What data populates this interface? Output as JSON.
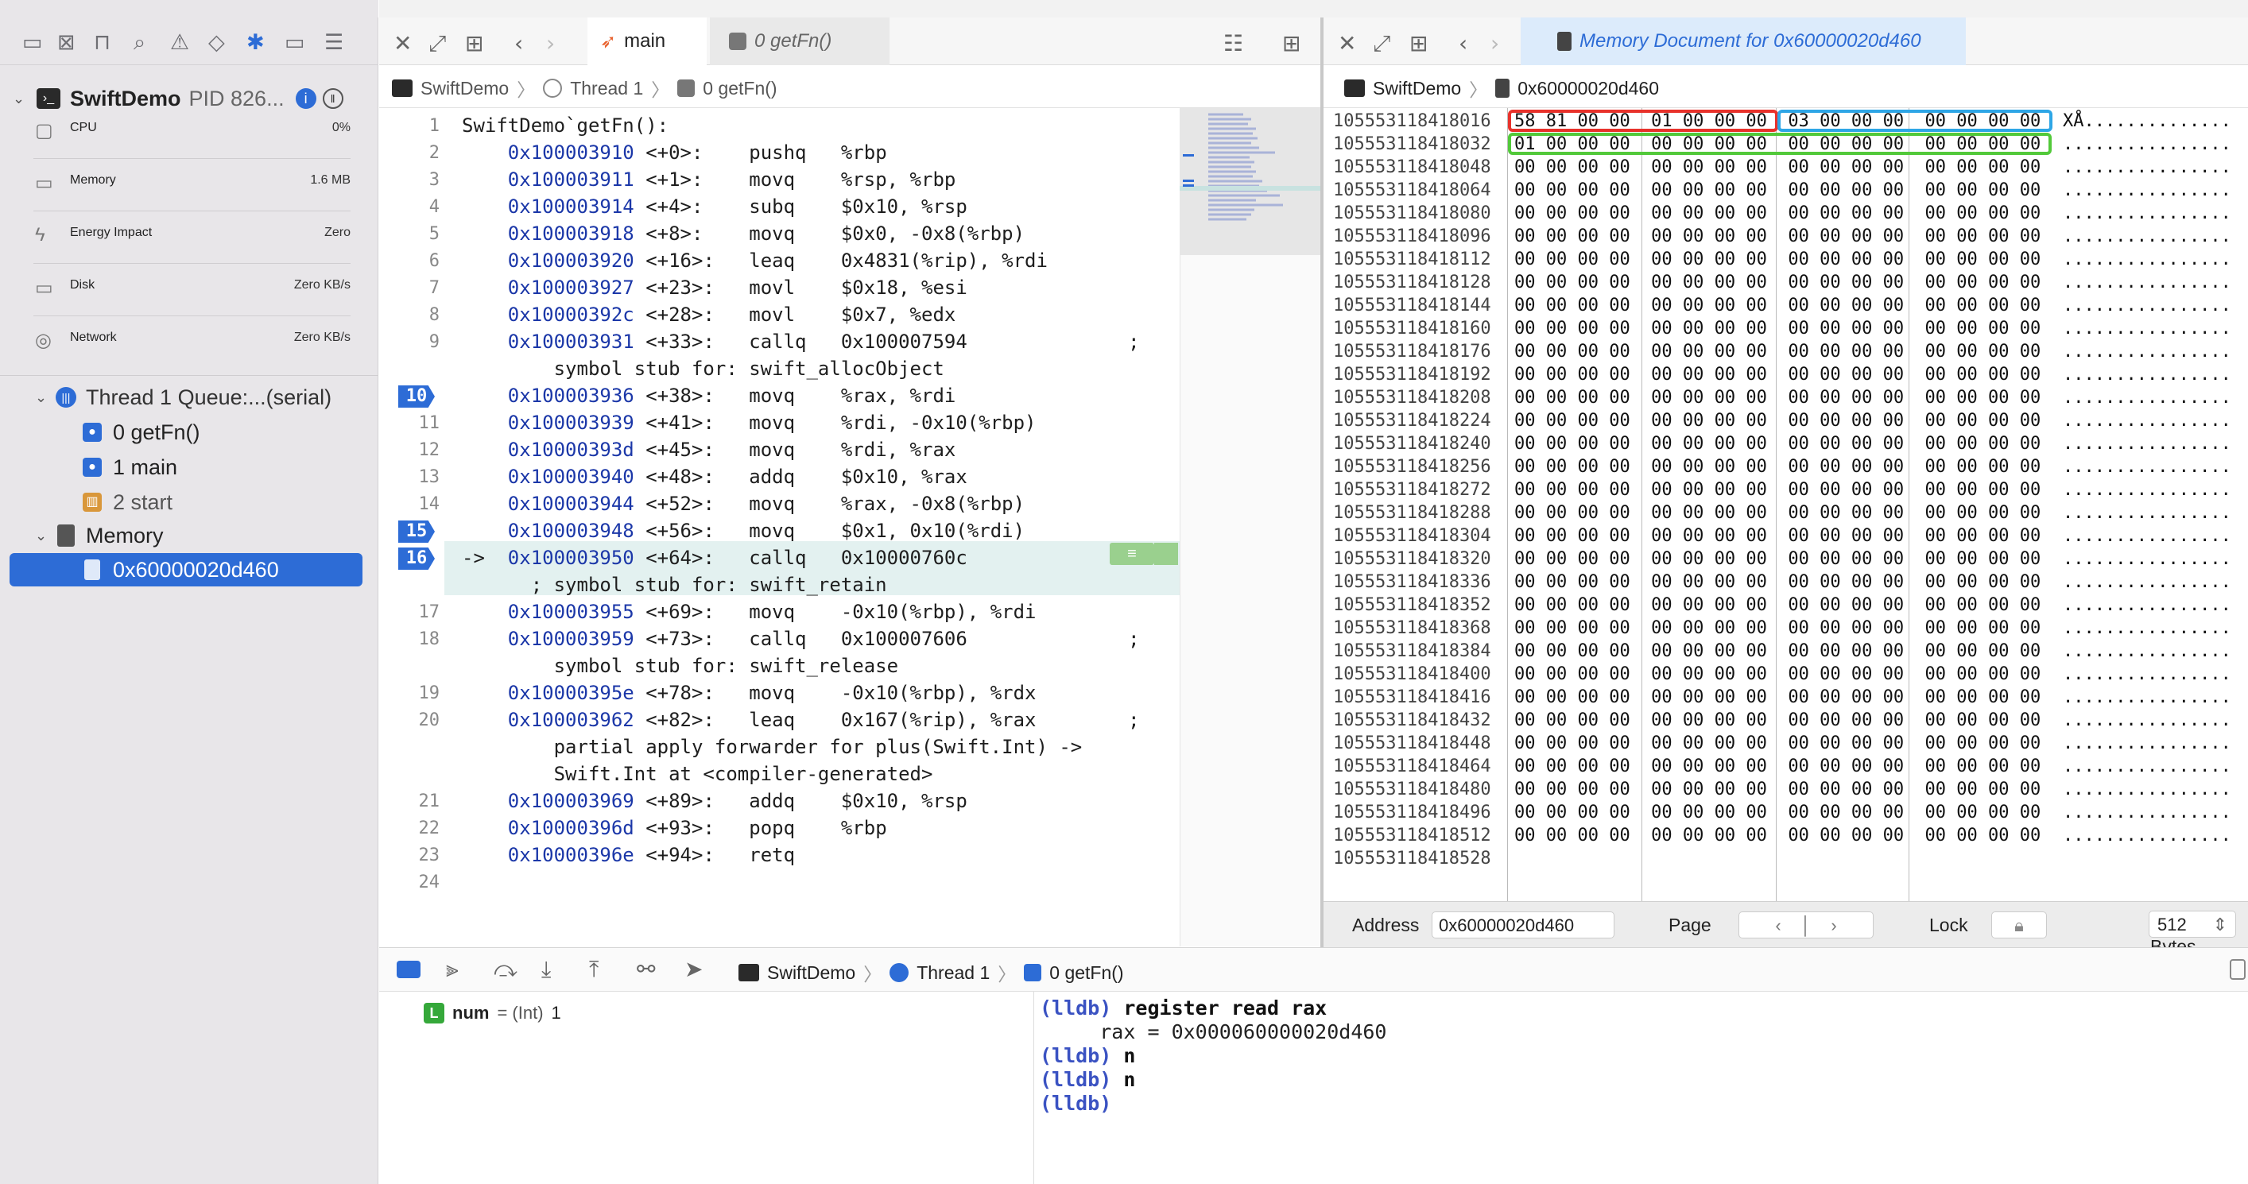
{
  "navigator": {
    "process": {
      "name": "SwiftDemo",
      "pid": "PID 826..."
    },
    "gauges": [
      {
        "label": "CPU",
        "value": "0%"
      },
      {
        "label": "Memory",
        "value": "1.6 MB"
      },
      {
        "label": "Energy Impact",
        "value": "Zero"
      },
      {
        "label": "Disk",
        "value": "Zero KB/s"
      },
      {
        "label": "Network",
        "value": "Zero KB/s"
      }
    ],
    "thread": "Thread 1 Queue:...(serial)",
    "frames": [
      "0 getFn()",
      "1 main",
      "2 start"
    ],
    "memory_group": "Memory",
    "memory_item": "0x60000020d460"
  },
  "editor": {
    "tab_main": "main",
    "tab_frame": "0 getFn()",
    "jump": [
      "SwiftDemo",
      "Thread 1",
      "0 getFn()"
    ],
    "lines": [
      {
        "n": "1",
        "text": "SwiftDemo`getFn():"
      },
      {
        "n": "2",
        "addr": "0x100003910",
        "off": "<+0>",
        "instr": "pushq   %rbp"
      },
      {
        "n": "3",
        "addr": "0x100003911",
        "off": "<+1>",
        "instr": "movq    %rsp, %rbp"
      },
      {
        "n": "4",
        "addr": "0x100003914",
        "off": "<+4>",
        "instr": "subq    $0x10, %rsp"
      },
      {
        "n": "5",
        "addr": "0x100003918",
        "off": "<+8>",
        "instr": "movq    $0x0, -0x8(%rbp)"
      },
      {
        "n": "6",
        "addr": "0x100003920",
        "off": "<+16>",
        "instr": "leaq    0x4831(%rip), %rdi"
      },
      {
        "n": "7",
        "addr": "0x100003927",
        "off": "<+23>",
        "instr": "movl    $0x18, %esi"
      },
      {
        "n": "8",
        "addr": "0x10000392c",
        "off": "<+28>",
        "instr": "movl    $0x7, %edx"
      },
      {
        "n": "9",
        "addr": "0x100003931",
        "off": "<+33>",
        "instr": "callq   0x100007594              ;"
      },
      {
        "n": "",
        "text": "        symbol stub for: swift_allocObject"
      },
      {
        "n": "10",
        "addr": "0x100003936",
        "off": "<+38>",
        "instr": "movq    %rax, %rdi",
        "bp": true
      },
      {
        "n": "11",
        "addr": "0x100003939",
        "off": "<+41>",
        "instr": "movq    %rdi, -0x10(%rbp)"
      },
      {
        "n": "12",
        "addr": "0x10000393d",
        "off": "<+45>",
        "instr": "movq    %rdi, %rax"
      },
      {
        "n": "13",
        "addr": "0x100003940",
        "off": "<+48>",
        "instr": "addq    $0x10, %rax"
      },
      {
        "n": "14",
        "addr": "0x100003944",
        "off": "<+52>",
        "instr": "movq    %rax, -0x8(%rbp)"
      },
      {
        "n": "15",
        "addr": "0x100003948",
        "off": "<+56>",
        "instr": "movq    $0x1, 0x10(%rdi)",
        "bp": true
      },
      {
        "n": "16",
        "addr": "0x100003950",
        "off": "<+64>",
        "instr": "callq   0x10000760c",
        "bp": true,
        "arrow": "->"
      },
      {
        "n": "",
        "text": "      ; symbol stub for: swift_retain"
      },
      {
        "n": "17",
        "addr": "0x100003955",
        "off": "<+69>",
        "instr": "movq    -0x10(%rbp), %rdi"
      },
      {
        "n": "18",
        "addr": "0x100003959",
        "off": "<+73>",
        "instr": "callq   0x100007606              ;"
      },
      {
        "n": "",
        "text": "        symbol stub for: swift_release"
      },
      {
        "n": "19",
        "addr": "0x10000395e",
        "off": "<+78>",
        "instr": "movq    -0x10(%rbp), %rdx"
      },
      {
        "n": "20",
        "addr": "0x100003962",
        "off": "<+82>",
        "instr": "leaq    0x167(%rip), %rax        ;"
      },
      {
        "n": "",
        "text": "        partial apply forwarder for plus(Swift.Int) ->"
      },
      {
        "n": "",
        "text": "        Swift.Int at <compiler-generated>"
      },
      {
        "n": "21",
        "addr": "0x100003969",
        "off": "<+89>",
        "instr": "addq    $0x10, %rsp"
      },
      {
        "n": "22",
        "addr": "0x10000396d",
        "off": "<+93>",
        "instr": "popq    %rbp"
      },
      {
        "n": "23",
        "addr": "0x10000396e",
        "off": "<+94>",
        "instr": "retq"
      },
      {
        "n": "24",
        "text": ""
      }
    ]
  },
  "memory": {
    "title": "Memory Document for 0x60000020d460",
    "jump": [
      "SwiftDemo",
      "0x60000020d460"
    ],
    "rows": [
      {
        "a": "105553118418016",
        "h": "58 81 00 00 01 00 00 00 03 00 00 00 00 00 00 00",
        "s": "XÅ.............."
      },
      {
        "a": "105553118418032",
        "h": "01 00 00 00 00 00 00 00 00 00 00 00 00 00 00 00",
        "s": "................"
      },
      {
        "a": "105553118418048",
        "h": "00 00 00 00 00 00 00 00 00 00 00 00 00 00 00 00",
        "s": "................"
      },
      {
        "a": "105553118418064",
        "h": "00 00 00 00 00 00 00 00 00 00 00 00 00 00 00 00",
        "s": "................"
      },
      {
        "a": "105553118418080",
        "h": "00 00 00 00 00 00 00 00 00 00 00 00 00 00 00 00",
        "s": "................"
      },
      {
        "a": "105553118418096",
        "h": "00 00 00 00 00 00 00 00 00 00 00 00 00 00 00 00",
        "s": "................"
      },
      {
        "a": "105553118418112",
        "h": "00 00 00 00 00 00 00 00 00 00 00 00 00 00 00 00",
        "s": "................"
      },
      {
        "a": "105553118418128",
        "h": "00 00 00 00 00 00 00 00 00 00 00 00 00 00 00 00",
        "s": "................"
      },
      {
        "a": "105553118418144",
        "h": "00 00 00 00 00 00 00 00 00 00 00 00 00 00 00 00",
        "s": "................"
      },
      {
        "a": "105553118418160",
        "h": "00 00 00 00 00 00 00 00 00 00 00 00 00 00 00 00",
        "s": "................"
      },
      {
        "a": "105553118418176",
        "h": "00 00 00 00 00 00 00 00 00 00 00 00 00 00 00 00",
        "s": "................"
      },
      {
        "a": "105553118418192",
        "h": "00 00 00 00 00 00 00 00 00 00 00 00 00 00 00 00",
        "s": "................"
      },
      {
        "a": "105553118418208",
        "h": "00 00 00 00 00 00 00 00 00 00 00 00 00 00 00 00",
        "s": "................"
      },
      {
        "a": "105553118418224",
        "h": "00 00 00 00 00 00 00 00 00 00 00 00 00 00 00 00",
        "s": "................"
      },
      {
        "a": "105553118418240",
        "h": "00 00 00 00 00 00 00 00 00 00 00 00 00 00 00 00",
        "s": "................"
      },
      {
        "a": "105553118418256",
        "h": "00 00 00 00 00 00 00 00 00 00 00 00 00 00 00 00",
        "s": "................"
      },
      {
        "a": "105553118418272",
        "h": "00 00 00 00 00 00 00 00 00 00 00 00 00 00 00 00",
        "s": "................"
      },
      {
        "a": "105553118418288",
        "h": "00 00 00 00 00 00 00 00 00 00 00 00 00 00 00 00",
        "s": "................"
      },
      {
        "a": "105553118418304",
        "h": "00 00 00 00 00 00 00 00 00 00 00 00 00 00 00 00",
        "s": "................"
      },
      {
        "a": "105553118418320",
        "h": "00 00 00 00 00 00 00 00 00 00 00 00 00 00 00 00",
        "s": "................"
      },
      {
        "a": "105553118418336",
        "h": "00 00 00 00 00 00 00 00 00 00 00 00 00 00 00 00",
        "s": "................"
      },
      {
        "a": "105553118418352",
        "h": "00 00 00 00 00 00 00 00 00 00 00 00 00 00 00 00",
        "s": "................"
      },
      {
        "a": "105553118418368",
        "h": "00 00 00 00 00 00 00 00 00 00 00 00 00 00 00 00",
        "s": "................"
      },
      {
        "a": "105553118418384",
        "h": "00 00 00 00 00 00 00 00 00 00 00 00 00 00 00 00",
        "s": "................"
      },
      {
        "a": "105553118418400",
        "h": "00 00 00 00 00 00 00 00 00 00 00 00 00 00 00 00",
        "s": "................"
      },
      {
        "a": "105553118418416",
        "h": "00 00 00 00 00 00 00 00 00 00 00 00 00 00 00 00",
        "s": "................"
      },
      {
        "a": "105553118418432",
        "h": "00 00 00 00 00 00 00 00 00 00 00 00 00 00 00 00",
        "s": "................"
      },
      {
        "a": "105553118418448",
        "h": "00 00 00 00 00 00 00 00 00 00 00 00 00 00 00 00",
        "s": "................"
      },
      {
        "a": "105553118418464",
        "h": "00 00 00 00 00 00 00 00 00 00 00 00 00 00 00 00",
        "s": "................"
      },
      {
        "a": "105553118418480",
        "h": "00 00 00 00 00 00 00 00 00 00 00 00 00 00 00 00",
        "s": "................"
      },
      {
        "a": "105553118418496",
        "h": "00 00 00 00 00 00 00 00 00 00 00 00 00 00 00 00",
        "s": "................"
      },
      {
        "a": "105553118418512",
        "h": "00 00 00 00 00 00 00 00 00 00 00 00 00 00 00 00",
        "s": "................"
      },
      {
        "a": "105553118418528",
        "h": "",
        "s": ""
      }
    ],
    "highlight_colors": {
      "red": "#e8322b",
      "blue": "#2ea6e6",
      "green": "#52c93a"
    },
    "footer": {
      "address_label": "Address",
      "address_value": "0x60000020d460",
      "page_label": "Page",
      "lock_label": "Lock",
      "bytes_label": "Number of Bytes",
      "bytes_value": "512"
    }
  },
  "debug_bar": {
    "jump": [
      "SwiftDemo",
      "Thread 1",
      "0 getFn()"
    ]
  },
  "variables": [
    {
      "badge": "L",
      "name": "num",
      "type": "= (Int)",
      "value": "1"
    }
  ],
  "console": [
    {
      "prompt": "(lldb)",
      "cmd": "register read rax"
    },
    {
      "prompt": "",
      "out": "     rax = 0x000060000020d460"
    },
    {
      "prompt": "(lldb)",
      "cmd": "n"
    },
    {
      "prompt": "(lldb)",
      "cmd": "n"
    },
    {
      "prompt": "(lldb)",
      "cmd": ""
    }
  ],
  "colors": {
    "accent": "#2d6cd6",
    "selection": "#2d6cd6",
    "current_line": "#e3f1f0"
  }
}
